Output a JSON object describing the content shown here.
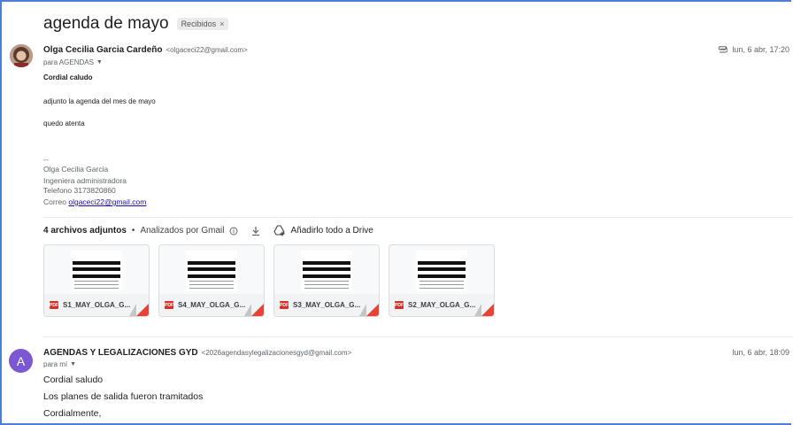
{
  "thread": {
    "subject": "agenda de mayo",
    "label": "Recibidos",
    "label_close": "×"
  },
  "message1": {
    "sender_name": "Olga Cecilia Garcia Cardeño",
    "sender_email": "<olgaceci22@gmail.com>",
    "to": "para AGENDAS",
    "date": "lun, 6 abr, 17:20",
    "greeting": "Cordial caludo",
    "line1": "adjunto la agenda del mes de mayo",
    "line2": "quedo atenta",
    "sig_dash": "--",
    "sig_name": "Olga Cecilia Garcia",
    "sig_title": "Ingeniera administradora",
    "sig_phone": "Telefono 3173820860",
    "sig_mail_prefix": "Correo",
    "sig_mail_link": "olgaceci22@gmail.com"
  },
  "attachments_bar": {
    "count": "4 archivos adjuntos",
    "separator": "•",
    "scanned": "Analizados por Gmail",
    "drive": "Añadirlo todo a Drive"
  },
  "attachments": [
    {
      "name": "S1_MAY_OLGA_G...",
      "type": "PDF"
    },
    {
      "name": "S4_MAY_OLGA_G...",
      "type": "PDF"
    },
    {
      "name": "S3_MAY_OLGA_G...",
      "type": "PDF"
    },
    {
      "name": "S2_MAY_OLGA_G...",
      "type": "PDF"
    }
  ],
  "message2": {
    "avatar_letter": "A",
    "sender_name": "AGENDAS Y LEGALIZACIONES GYD",
    "sender_email": "<2026agendasylegalizacionesgyd@gmail.com>",
    "to": "para mí",
    "date": "lun, 6 abr, 18:09",
    "line1": "Cordial saludo",
    "line2": "Los planes de salida fueron tramitados",
    "line3": "Cordialmente,"
  },
  "colors": {
    "frame": "#4a7fd4",
    "avatar2": "#7b57d1",
    "pdf": "#d93025",
    "link": "#1a0dab"
  }
}
